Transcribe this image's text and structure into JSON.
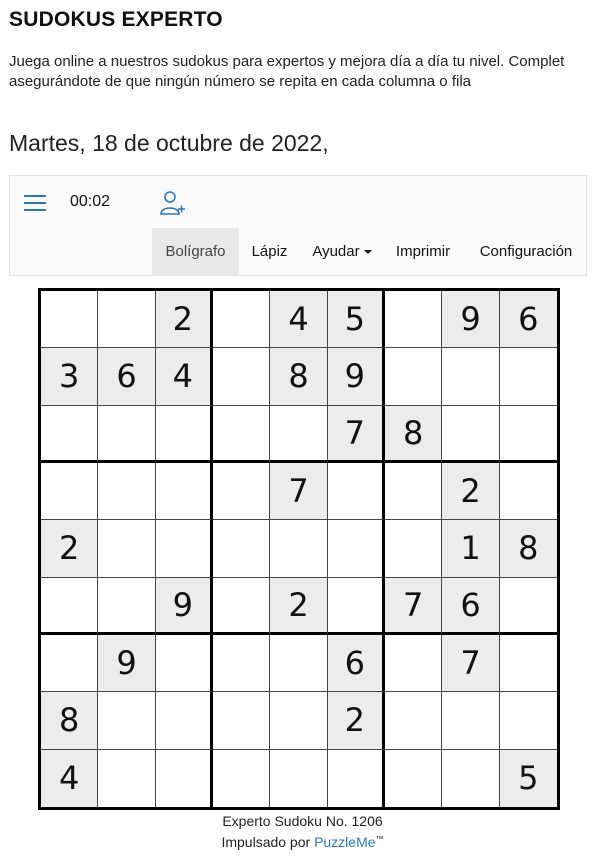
{
  "page": {
    "title": "SUDOKUS EXPERTO",
    "intro_line1": "Juega online a nuestros sudokus para expertos y mejora día a día tu nivel. Complet",
    "intro_line2": "asegurándote de que ningún número se repita en cada columna o fila",
    "date": "Martes, 18 de octubre de 2022,"
  },
  "toolbar": {
    "menu_icon": "hamburger-menu-icon",
    "timer": "00:02",
    "add_user_icon": "add-user-icon",
    "tabs": [
      {
        "label": "Bolígrafo",
        "active": true
      },
      {
        "label": "Lápiz"
      },
      {
        "label": "Ayudar",
        "has_dropdown": true
      },
      {
        "label": "Imprimir"
      },
      {
        "label": "Configuración"
      }
    ]
  },
  "puzzle": {
    "grid": [
      [
        "",
        "",
        "2",
        "",
        "4",
        "5",
        "",
        "9",
        "6"
      ],
      [
        "3",
        "6",
        "4",
        "",
        "8",
        "9",
        "",
        "",
        ""
      ],
      [
        "",
        "",
        "",
        "",
        "",
        "7",
        "8",
        "",
        ""
      ],
      [
        "",
        "",
        "",
        "",
        "7",
        "",
        "",
        "2",
        ""
      ],
      [
        "2",
        "",
        "",
        "",
        "",
        "",
        "",
        "1",
        "8"
      ],
      [
        "",
        "",
        "9",
        "",
        "2",
        "",
        "7",
        "6",
        ""
      ],
      [
        "",
        "9",
        "",
        "",
        "",
        "6",
        "",
        "7",
        ""
      ],
      [
        "8",
        "",
        "",
        "",
        "",
        "2",
        "",
        "",
        ""
      ],
      [
        "4",
        "",
        "",
        "",
        "",
        "",
        "",
        "",
        "5"
      ]
    ]
  },
  "footer": {
    "puzzle_id": "Experto Sudoku No. 1206",
    "powered_by": "Impulsado por",
    "brand": "PuzzleMe",
    "trademark": "™"
  },
  "colors": {
    "accent": "#2a7ab8",
    "given_cell_bg": "#ececec",
    "active_tab_bg": "#e8e8e8"
  }
}
